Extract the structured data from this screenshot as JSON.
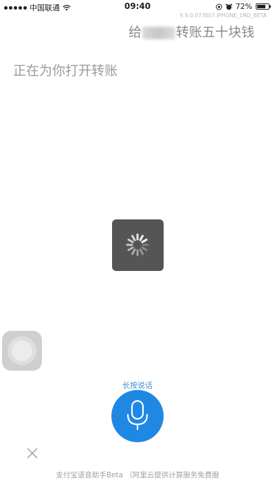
{
  "status_bar": {
    "carrier": "中国联通",
    "time": "09:40",
    "battery_percent_text": "72%",
    "battery_level": 0.72,
    "icons": [
      "signal-dots-icon",
      "wifi-icon",
      "location-icon",
      "alarm-icon",
      "battery-icon"
    ]
  },
  "app": {
    "version": "9.9.0.073007.IPHONE_1ND_BETA",
    "query_prefix": "给",
    "query_suffix": "转账五十块钱",
    "status_message": "正在为你打开转账"
  },
  "voice": {
    "hint": "长按说话",
    "mic_icon": "microphone-icon",
    "close_icon": "close-icon"
  },
  "footer": {
    "text": "支付宝语音助手Beta （阿里云提供计算服务免费服"
  },
  "colors": {
    "accent": "#1f88e5",
    "hint": "#3b8fd9",
    "spinner_bg": "#555555"
  }
}
